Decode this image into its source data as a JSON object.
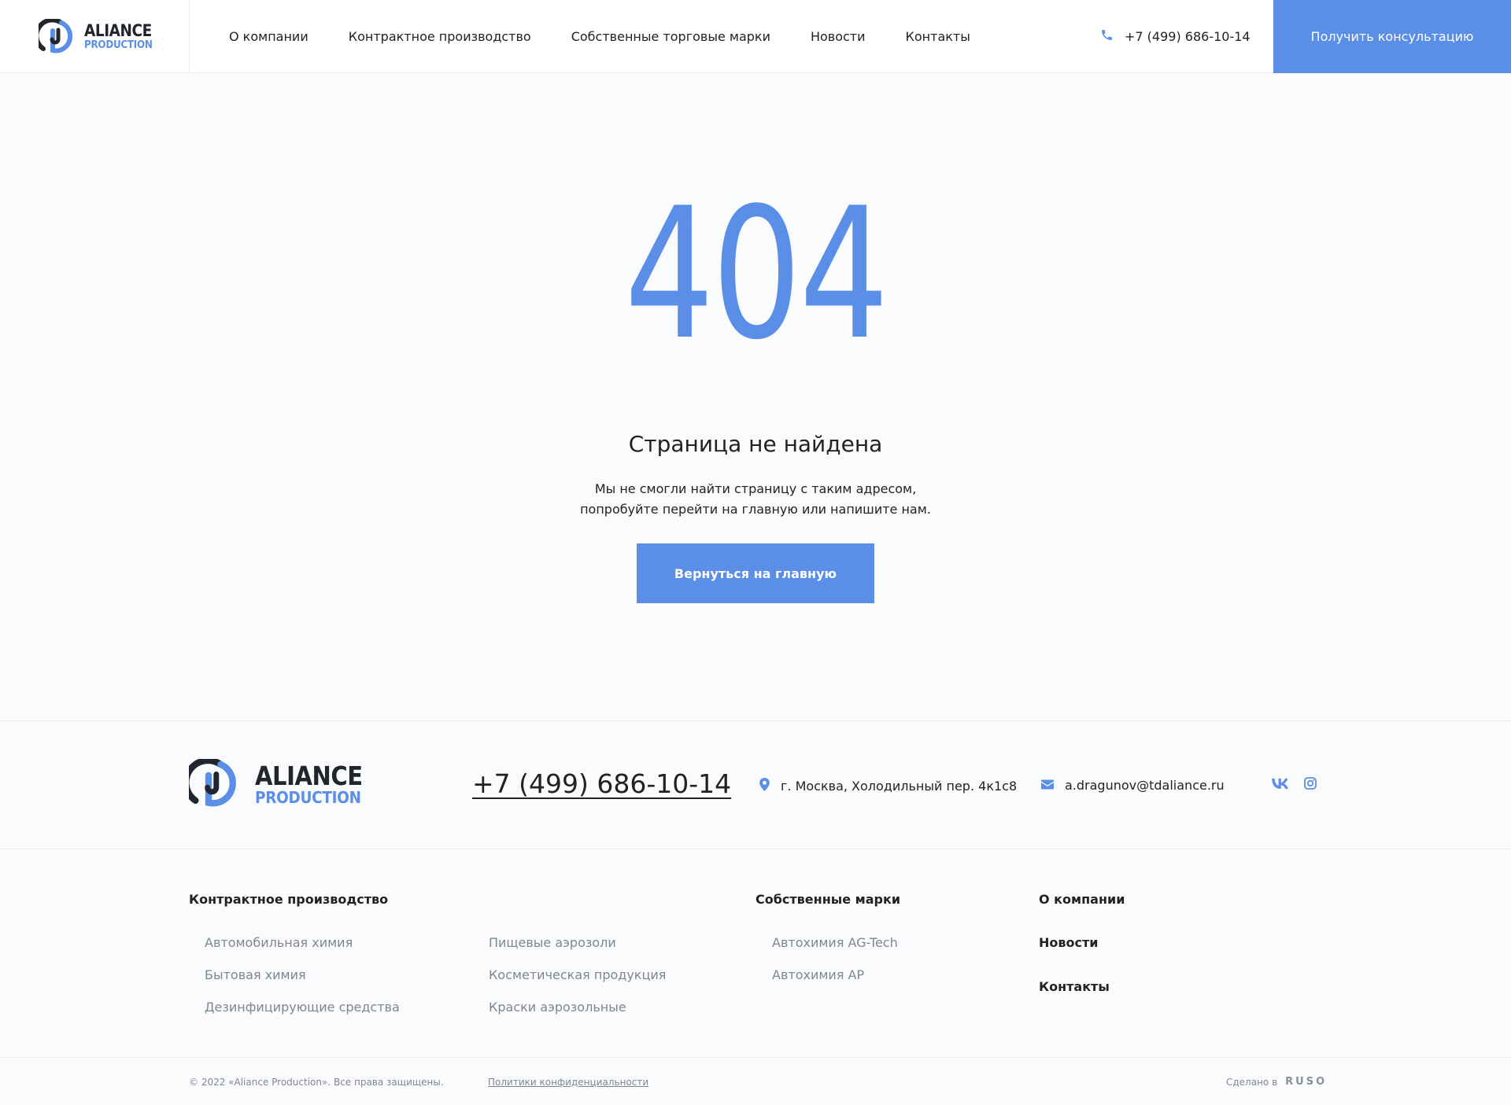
{
  "header": {
    "logo": {
      "line1": "ALIANCE",
      "line2": "PRODUCTION"
    },
    "nav": [
      "О компании",
      "Контрактное производство",
      "Собственные торговые марки",
      "Новости",
      "Контакты"
    ],
    "phone": "+7 (499) 686-10-14",
    "cta_label": "Получить консультацию"
  },
  "error": {
    "code": "404",
    "title": "Страница не найдена",
    "text": "Мы не смогли найти страницу с таким адресом, попробуйте перейти на главную или напишите нам.",
    "button_label": "Вернуться на главную"
  },
  "footer": {
    "logo": {
      "line1": "ALIANCE",
      "line2": "PRODUCTION"
    },
    "phone": "+7 (499) 686-10-14",
    "address": "г. Москва, Холодильный пер. 4к1с8",
    "email": "a.dragunov@tdaliance.ru",
    "social": [
      "vk-icon",
      "instagram-icon"
    ],
    "contract": {
      "title": "Контрактное производство",
      "col1": [
        "Автомобильная химия",
        "Бытовая химия",
        "Дезинфицирующие средства"
      ],
      "col2": [
        "Пищевые аэрозоли",
        "Косметическая продукция",
        "Краски аэрозольные"
      ]
    },
    "brands": {
      "title": "Собственные марки",
      "items": [
        "Автохимия AG-Tech",
        "Автохимия AP"
      ]
    },
    "about": {
      "title": "О компании",
      "items": [
        "Новости",
        "Контакты"
      ]
    },
    "copyright": "© 2022 «Aliance Production». Все права защищены.",
    "privacy": "Политики конфиденциальности",
    "made_by": "Сделано в",
    "made_brand": "RUSO"
  },
  "colors": {
    "accent": "#5b8ee6",
    "text": "#222222",
    "muted": "#808590",
    "background": "#fafbfd"
  }
}
